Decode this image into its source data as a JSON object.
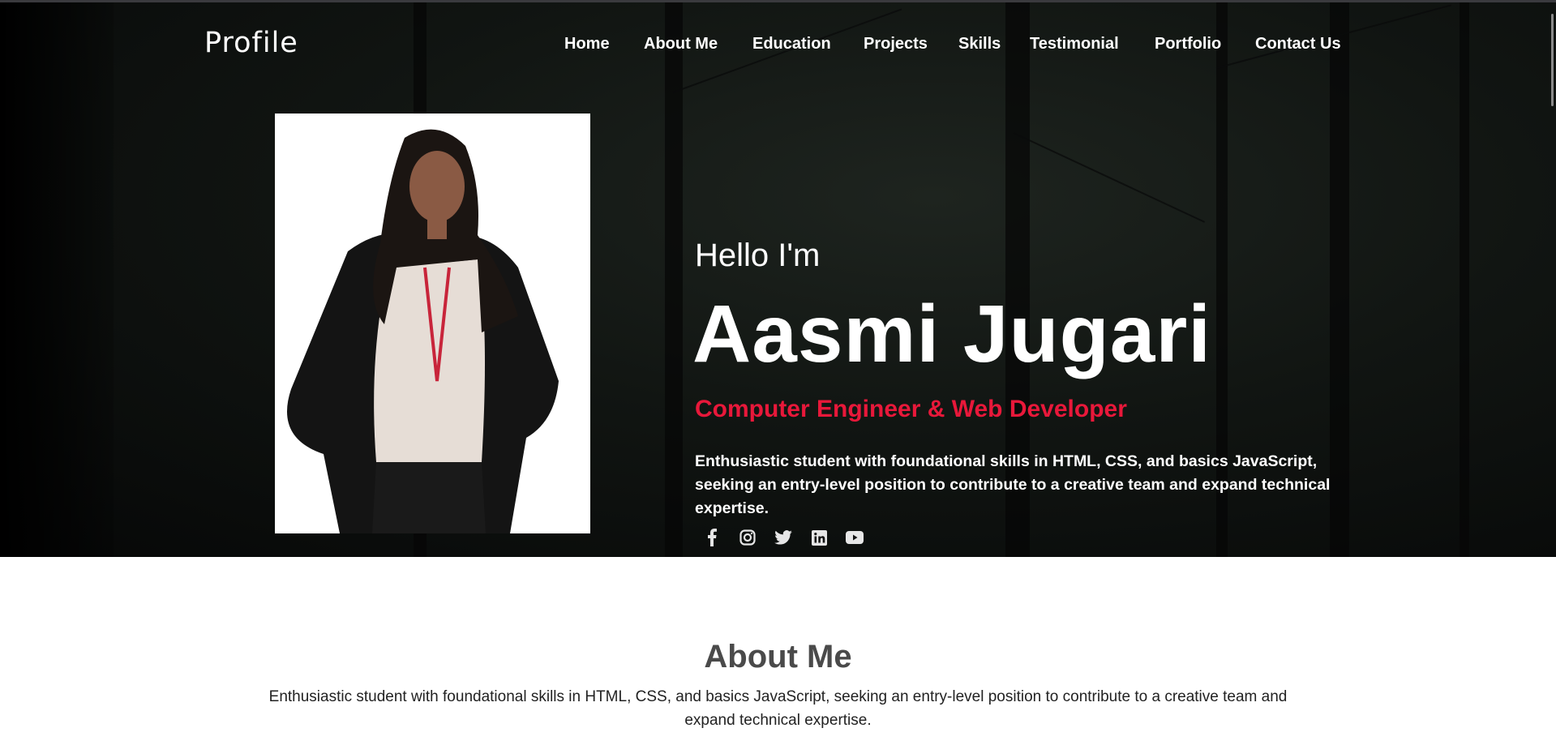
{
  "header": {
    "logo": "Profile",
    "nav": [
      "Home",
      "About Me",
      "Education",
      "Projects",
      "Skills",
      "Testimonial",
      "Portfolio",
      "Contact Us"
    ]
  },
  "hero": {
    "greeting": "Hello I'm",
    "name": "Aasmi Jugari",
    "role": "Computer Engineer & Web Developer",
    "description": "Enthusiastic student with foundational skills in HTML, CSS, and basics JavaScript, seeking an entry-level position to contribute to a creative team and expand technical expertise.",
    "social": [
      "facebook-icon",
      "instagram-icon",
      "twitter-icon",
      "linkedin-icon",
      "youtube-icon"
    ],
    "accent": "#e8183a"
  },
  "about": {
    "title": "About Me",
    "text": "Enthusiastic student with foundational skills in HTML, CSS, and basics JavaScript, seeking an entry-level position to contribute to a creative team and expand technical expertise."
  }
}
